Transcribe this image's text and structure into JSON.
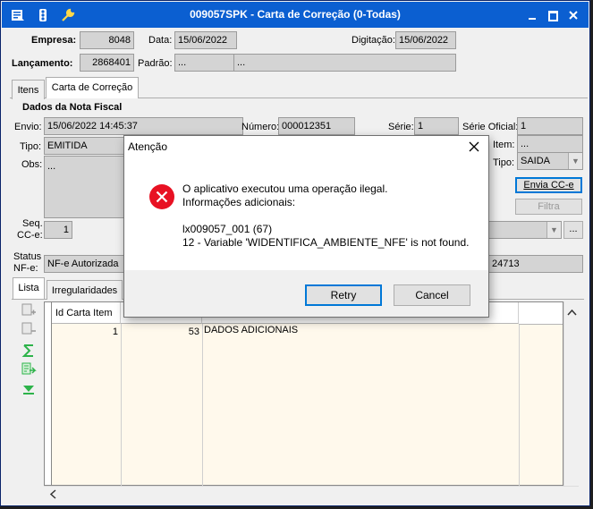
{
  "window": {
    "title": "009057SPK - Carta de Correção (0-Todas)"
  },
  "header": {
    "empresa_label": "Empresa:",
    "empresa_value": "8048",
    "data_label": "Data:",
    "data_value": "15/06/2022",
    "digitacao_label": "Digitação:",
    "digitacao_value": "15/06/2022",
    "lancamento_label": "Lançamento:",
    "lancamento_value": "2868401",
    "padrao_label": "Padrão:",
    "padrao_value": "...",
    "padrao_desc": "..."
  },
  "tabs": [
    "Itens",
    "Carta de Correção"
  ],
  "section": {
    "title": "Dados da Nota Fiscal",
    "envio_label": "Envio:",
    "envio_value": "15/06/2022 14:45:37",
    "numero_label": "Número:",
    "numero_value": "000012351",
    "serie_label": "Série:",
    "serie_value": "1",
    "serie_oficial_label": "Série Oficial:",
    "serie_oficial_value": "1",
    "tipo_label": "Tipo:",
    "tipo_value": "EMITIDA",
    "item_label": "Item:",
    "item_value": "...",
    "tipo2_label": "Tipo:",
    "tipo2_value": "SAIDA",
    "obs_label": "Obs:",
    "obs_value": "...",
    "envia_cce_button": "Envia CC-e",
    "filtra_button": "Filtra",
    "seq_label_1": "Seq.",
    "seq_label_2": "CC-e:",
    "seq_value": "1",
    "combo_button": "...",
    "status_label_1": "Status",
    "status_label_2": "NF-e:",
    "status_value": "NF-e Autorizada",
    "protocolo_partial": "24713"
  },
  "subtabs": [
    "Lista",
    "Irregularidades"
  ],
  "grid": {
    "columns": [
      "Id Carta Item",
      "",
      ""
    ],
    "rows": [
      {
        "id": "1",
        "num": "53",
        "desc": "DADOS ADICIONAIS"
      }
    ]
  },
  "dialog": {
    "title": "Atenção",
    "line1": "O aplicativo executou uma operação ilegal.",
    "line2": "Informações adicionais:",
    "line3": "lx009057_001 (67)",
    "line4": "12 - Variable 'WIDENTIFICA_AMBIENTE_NFE' is not found.",
    "retry_label": "Retry",
    "cancel_label": "Cancel",
    "icon": "error-icon"
  },
  "colors": {
    "titlebar": "#0b5fd1",
    "error_red": "#e81123",
    "grid_bg": "#fff9ec",
    "focus_blue": "#0078d7"
  }
}
